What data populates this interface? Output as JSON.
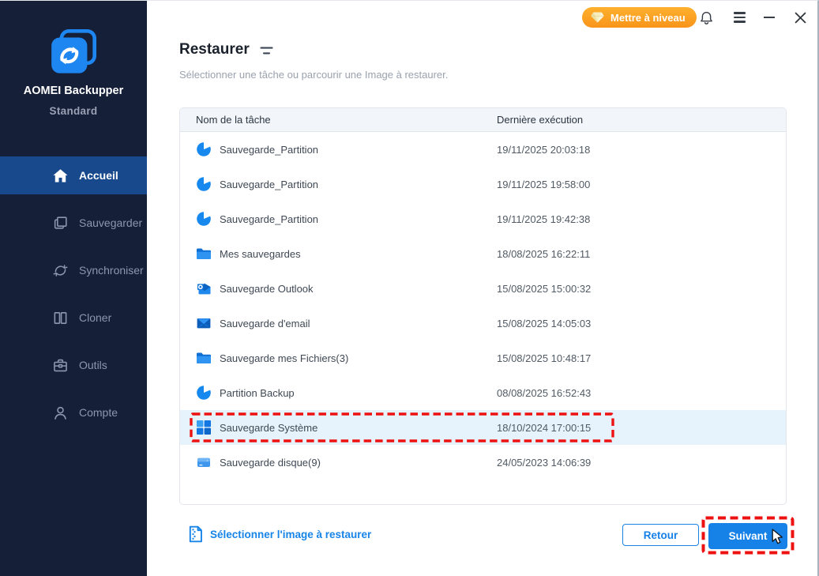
{
  "titlebar": {
    "upgrade_label": "Mettre à niveau"
  },
  "sidebar": {
    "brand": "AOMEI Backupper",
    "edition": "Standard",
    "items": [
      {
        "label": "Accueil",
        "icon": "home",
        "active": true
      },
      {
        "label": "Sauvegarder",
        "icon": "backup",
        "active": false
      },
      {
        "label": "Synchroniser",
        "icon": "sync",
        "active": false
      },
      {
        "label": "Cloner",
        "icon": "clone",
        "active": false
      },
      {
        "label": "Outils",
        "icon": "tools",
        "active": false
      },
      {
        "label": "Compte",
        "icon": "account",
        "active": false
      }
    ]
  },
  "main": {
    "title": "Restaurer",
    "subtitle": "Sélectionner une tâche ou parcourir une Image à restaurer.",
    "table": {
      "columns": [
        "Nom de la tâche",
        "Dernière exécution"
      ],
      "rows": [
        {
          "icon": "partition",
          "name": "Sauvegarde_Partition",
          "last_run": "19/11/2025 20:03:18",
          "selected": false
        },
        {
          "icon": "partition",
          "name": "Sauvegarde_Partition",
          "last_run": "19/11/2025 19:58:00",
          "selected": false
        },
        {
          "icon": "partition",
          "name": "Sauvegarde_Partition",
          "last_run": "19/11/2025 19:42:38",
          "selected": false
        },
        {
          "icon": "folder",
          "name": "Mes sauvegardes",
          "last_run": "18/08/2025 16:22:11",
          "selected": false
        },
        {
          "icon": "outlook",
          "name": "Sauvegarde Outlook",
          "last_run": "15/08/2025 15:00:32",
          "selected": false
        },
        {
          "icon": "mail",
          "name": "Sauvegarde d'email",
          "last_run": "15/08/2025 14:05:03",
          "selected": false
        },
        {
          "icon": "folder",
          "name": "Sauvegarde mes Fichiers(3)",
          "last_run": "15/08/2025 10:48:17",
          "selected": false
        },
        {
          "icon": "partition",
          "name": "Partition Backup",
          "last_run": "08/08/2025 16:52:43",
          "selected": false
        },
        {
          "icon": "windows",
          "name": "Sauvegarde Système",
          "last_run": "18/10/2024 17:00:15",
          "selected": true
        },
        {
          "icon": "disk",
          "name": "Sauvegarde disque(9)",
          "last_run": "24/05/2023 14:06:39",
          "selected": false
        }
      ]
    },
    "footer": {
      "select_image_label": "Sélectionner l'image à restaurer",
      "back_label": "Retour",
      "next_label": "Suivant"
    }
  },
  "colors": {
    "accent_blue": "#1784e8",
    "upgrade_orange": "#f8941a",
    "sidebar_bg": "#161f38",
    "sidebar_active_bg": "#17498c",
    "selected_row_bg": "#e7f3fc",
    "dashed_red": "#ee1111",
    "table_header_bg": "#f2f5f9"
  }
}
